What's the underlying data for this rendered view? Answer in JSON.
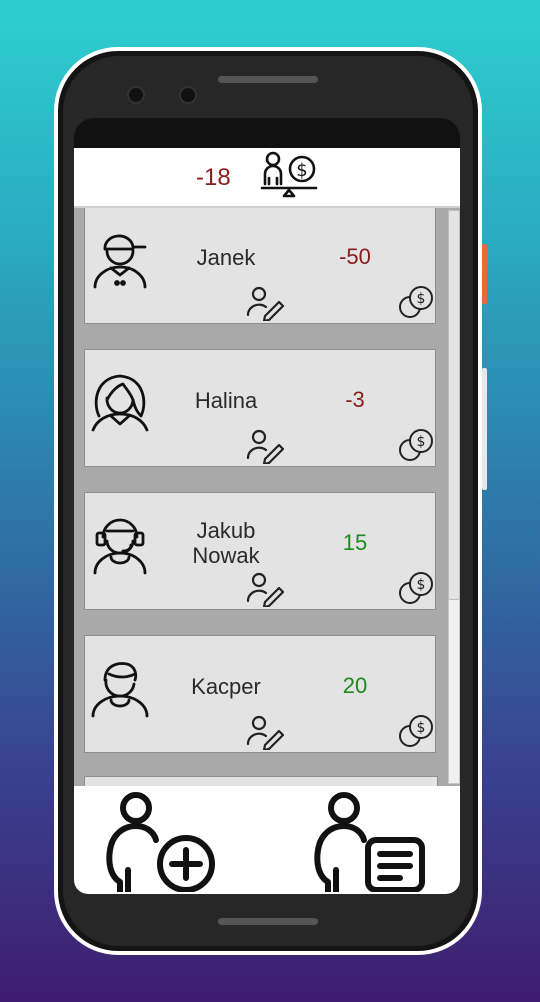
{
  "header": {
    "balance": "-18",
    "balance_icon": "balance-scale-person-coin-icon"
  },
  "people": [
    {
      "name": "Janek",
      "amount": "-50",
      "sign": "negative",
      "avatar": "cap-person-icon"
    },
    {
      "name": "Halina",
      "amount": "-3",
      "sign": "negative",
      "avatar": "woman-person-icon"
    },
    {
      "name": "Jakub\nNowak",
      "amount": "15",
      "sign": "positive",
      "avatar": "headset-person-icon"
    },
    {
      "name": "Kacper",
      "amount": "20",
      "sign": "positive",
      "avatar": "boy-person-icon"
    }
  ],
  "row_icons": {
    "edit": "edit-person-icon",
    "settle": "coins-icon"
  },
  "bottom": {
    "add": "add-person-icon",
    "list": "person-list-icon"
  },
  "colors": {
    "negative": "#8a1c1c",
    "positive": "#1e8a1e"
  }
}
